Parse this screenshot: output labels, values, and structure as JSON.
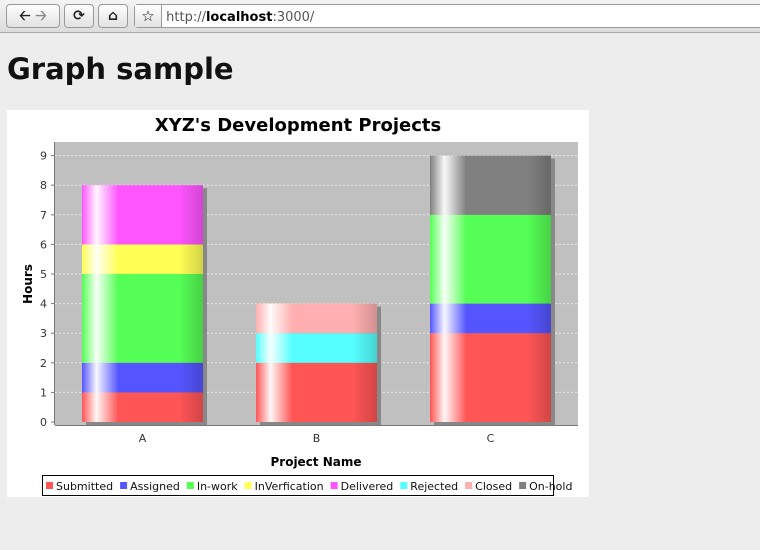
{
  "browser": {
    "url_prefix": "http://",
    "url_host": "localhost",
    "url_rest": ":3000/",
    "icons": [
      "back-icon",
      "forward-icon",
      "reload-icon",
      "home-icon",
      "star-icon"
    ]
  },
  "page": {
    "title": "Graph sample"
  },
  "chart_data": {
    "type": "bar",
    "stacked": true,
    "title": "XYZ's Development Projects",
    "xlabel": "Project Name",
    "ylabel": "Hours",
    "categories": [
      "A",
      "B",
      "C"
    ],
    "ylim": [
      0,
      9.5
    ],
    "yticks": [
      0,
      1,
      2,
      3,
      4,
      5,
      6,
      7,
      8,
      9
    ],
    "grid": true,
    "legend_position": "bottom",
    "series": [
      {
        "name": "Submitted",
        "color": "#ff5555",
        "values": [
          1,
          2,
          3
        ]
      },
      {
        "name": "Assigned",
        "color": "#5555ff",
        "values": [
          1,
          0,
          1
        ]
      },
      {
        "name": "In-work",
        "color": "#55ff55",
        "values": [
          3,
          0,
          3
        ]
      },
      {
        "name": "InVerfication",
        "color": "#ffff55",
        "values": [
          1,
          0,
          0
        ]
      },
      {
        "name": "Delivered",
        "color": "#ff55ff",
        "values": [
          2,
          0,
          0
        ]
      },
      {
        "name": "Rejected",
        "color": "#55ffff",
        "values": [
          0,
          1,
          0
        ]
      },
      {
        "name": "Closed",
        "color": "#ffafaf",
        "values": [
          0,
          1,
          0
        ]
      },
      {
        "name": "On-hold",
        "color": "#808080",
        "values": [
          0,
          0,
          2
        ]
      }
    ]
  }
}
